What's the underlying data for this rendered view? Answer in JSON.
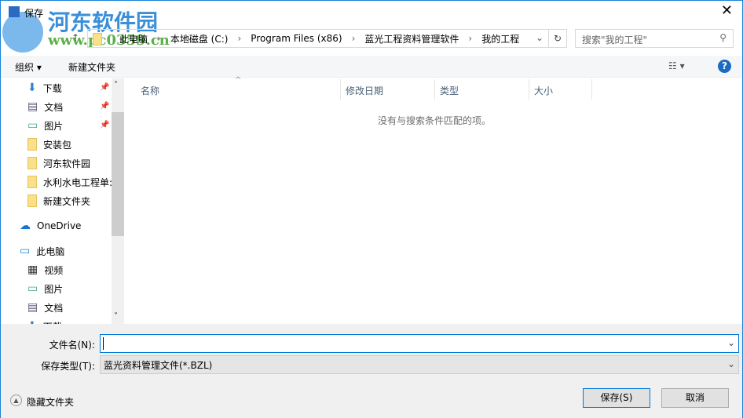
{
  "window": {
    "title": "保存",
    "close": "✕"
  },
  "watermark": {
    "line1": "河东软件园",
    "line2": "www.pc0359.cn"
  },
  "address": {
    "crumbs": [
      "此电脑",
      "本地磁盘 (C:)",
      "Program Files (x86)",
      "蓝光工程资料管理软件",
      "我的工程"
    ]
  },
  "search": {
    "placeholder": "搜索\"我的工程\""
  },
  "toolbar": {
    "organize": "组织 ▾",
    "new_folder": "新建文件夹",
    "help": "?"
  },
  "nav": {
    "items": [
      {
        "label": "下载",
        "icon": "download-icon",
        "pin": true
      },
      {
        "label": "文档",
        "icon": "document-icon",
        "pin": true
      },
      {
        "label": "图片",
        "icon": "pictures-icon",
        "pin": true
      },
      {
        "label": "安装包",
        "icon": "folder-icon"
      },
      {
        "label": "河东软件园",
        "icon": "folder-icon"
      },
      {
        "label": "水利水电工程单:",
        "icon": "folder-icon"
      },
      {
        "label": "新建文件夹",
        "icon": "folder-icon"
      },
      {
        "label": "OneDrive",
        "icon": "cloud-icon"
      },
      {
        "label": "此电脑",
        "icon": "computer-icon"
      },
      {
        "label": "视频",
        "icon": "video-icon"
      },
      {
        "label": "图片",
        "icon": "pictures-icon"
      },
      {
        "label": "文档",
        "icon": "document-icon"
      },
      {
        "label": "下载",
        "icon": "download-icon"
      }
    ]
  },
  "columns": [
    "名称",
    "修改日期",
    "类型",
    "大小"
  ],
  "empty_message": "没有与搜索条件匹配的项。",
  "form": {
    "filename_label": "文件名(N):",
    "filename_value": "",
    "filetype_label": "保存类型(T):",
    "filetype_value": "蓝光资料管理文件(*.BZL)"
  },
  "footer": {
    "hide_folders": "隐藏文件夹",
    "save": "保存(S)",
    "cancel": "取消"
  }
}
